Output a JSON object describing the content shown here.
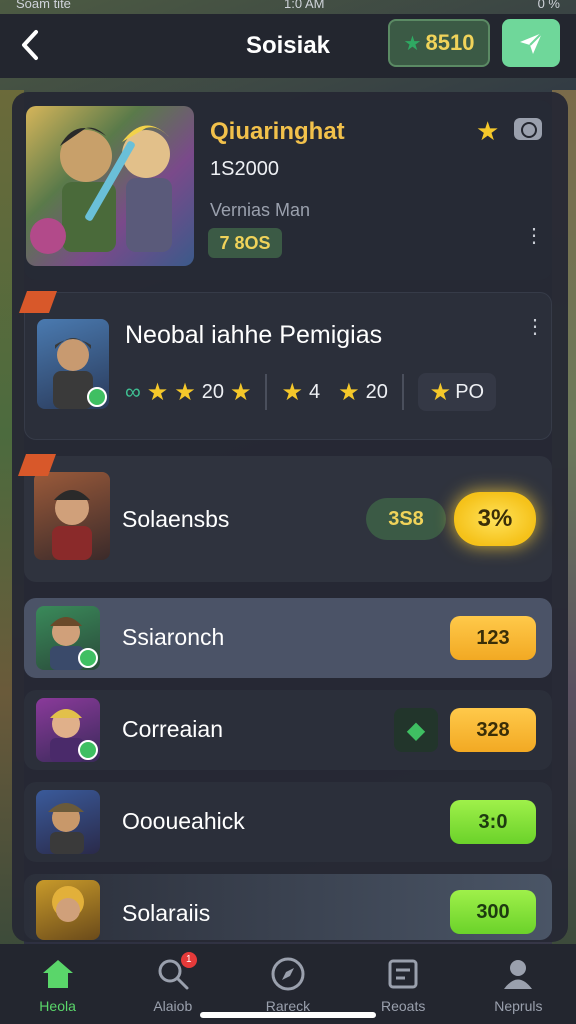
{
  "status_bar": {
    "left": "Soam tite",
    "center": "1:0 AM",
    "right": "0 %"
  },
  "header": {
    "title": "Soisiak",
    "coins": "8510",
    "colors": {
      "accent": "#6fd79a",
      "coin": "#f0d35a"
    }
  },
  "hero": {
    "title": "Qiuaringhat",
    "score": "1S2000",
    "subtitle": "Vernias Man",
    "badge": "7 8OS"
  },
  "featured": {
    "title": "Neobal iahhe Pemigias",
    "stat1": "20",
    "stat2": "4",
    "stat3": "20",
    "chip": "PO"
  },
  "rows": [
    {
      "name": "Solaensbs",
      "pill_left": "3S8",
      "pill_right": "3%"
    },
    {
      "name": "Ssiaronch",
      "value": "123"
    },
    {
      "name": "Correaian",
      "value": "328"
    },
    {
      "name": "Oooueahick",
      "value": "3:0"
    },
    {
      "name": "Solaraiis",
      "value": "300"
    }
  ],
  "nav": [
    {
      "label": "Heola",
      "icon": "home-icon",
      "active": true
    },
    {
      "label": "Alaiob",
      "icon": "search-icon",
      "badge": "1"
    },
    {
      "label": "Rareck",
      "icon": "compass-icon"
    },
    {
      "label": "Reoats",
      "icon": "reports-icon"
    },
    {
      "label": "Nepruls",
      "icon": "profile-icon"
    }
  ]
}
